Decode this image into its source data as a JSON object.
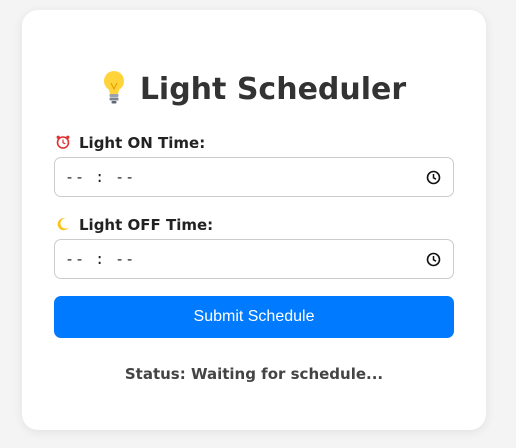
{
  "app": {
    "title": "Light Scheduler",
    "title_icon": "lightbulb-icon"
  },
  "form": {
    "on_time": {
      "label": "Light ON Time:",
      "icon": "alarm-clock-icon",
      "value": "-- : --"
    },
    "off_time": {
      "label": "Light OFF Time:",
      "icon": "crescent-moon-icon",
      "value": "-- : --"
    },
    "submit_label": "Submit Schedule"
  },
  "status": {
    "text": "Status: Waiting for schedule..."
  },
  "colors": {
    "accent": "#007bff",
    "card_background": "#ffffff",
    "page_background": "#f4f4f4",
    "title_text": "#333333"
  }
}
